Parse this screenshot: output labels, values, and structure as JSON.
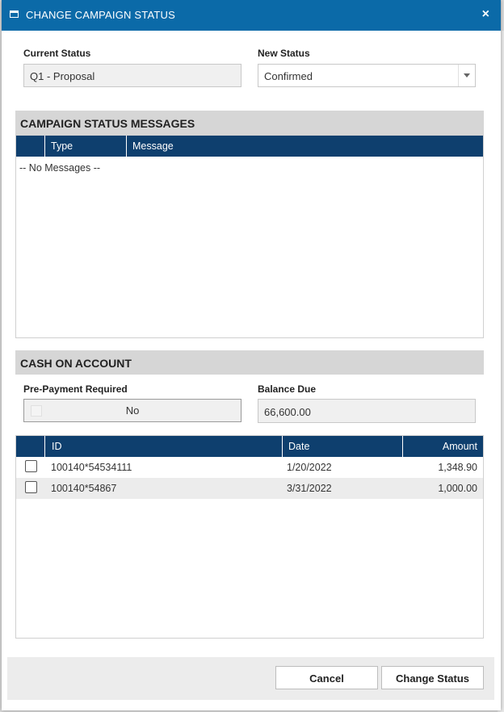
{
  "dialog": {
    "title": "CHANGE CAMPAIGN STATUS",
    "close_icon": "×"
  },
  "status": {
    "current_label": "Current Status",
    "current_value": "Q1 - Proposal",
    "new_label": "New Status",
    "new_value": "Confirmed"
  },
  "messages": {
    "header": "CAMPAIGN STATUS MESSAGES",
    "columns": [
      "Type",
      "Message"
    ],
    "empty_text": "-- No Messages --"
  },
  "cash": {
    "header": "CASH ON ACCOUNT",
    "prepayment_label": "Pre-Payment Required",
    "prepayment_value": "No",
    "balance_label": "Balance Due",
    "balance_value": "66,600.00",
    "columns": [
      "ID",
      "Date",
      "Amount"
    ],
    "rows": [
      {
        "id": "100140*54534111",
        "date": "1/20/2022",
        "amount": "1,348.90"
      },
      {
        "id": "100140*54867",
        "date": "3/31/2022",
        "amount": "1,000.00"
      }
    ]
  },
  "footer": {
    "cancel_label": "Cancel",
    "change_label": "Change Status"
  },
  "colors": {
    "titlebar": "#0b6aa8",
    "grid_header": "#0e3f6e",
    "section_header": "#d6d6d6"
  }
}
